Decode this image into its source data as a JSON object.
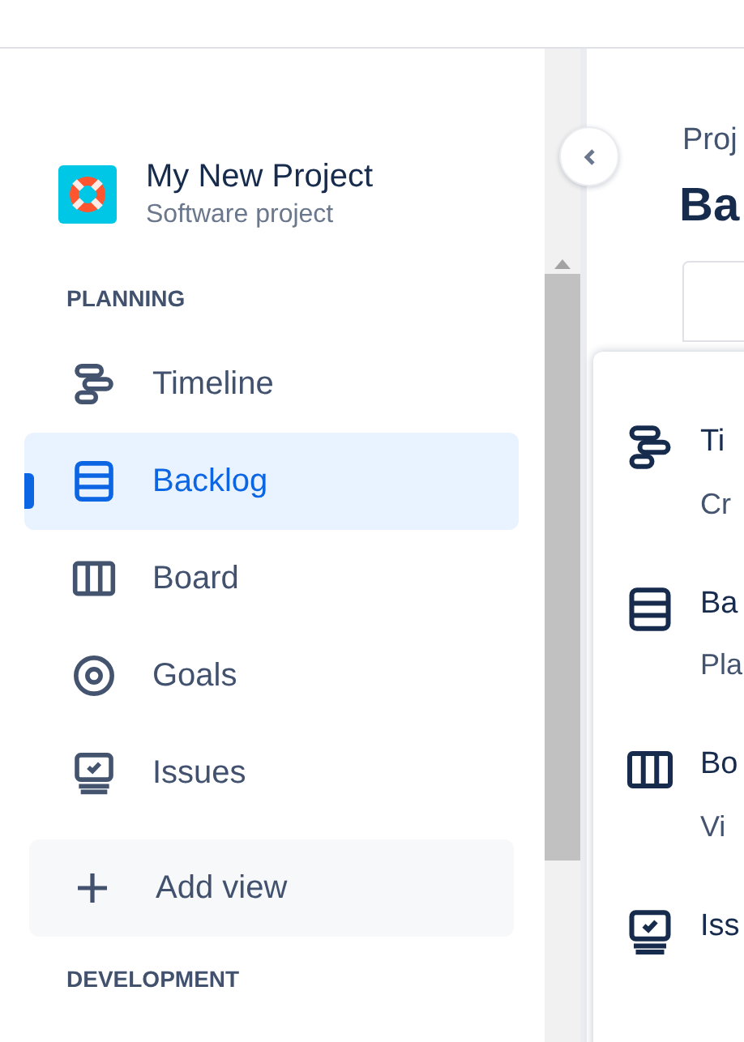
{
  "project": {
    "name": "My New Project",
    "type": "Software project"
  },
  "sections": [
    {
      "heading": "PLANNING",
      "items": [
        {
          "label": "Timeline",
          "kind": "timeline",
          "selected": false
        },
        {
          "label": "Backlog",
          "kind": "backlog",
          "selected": true
        },
        {
          "label": "Board",
          "kind": "board",
          "selected": false
        },
        {
          "label": "Goals",
          "kind": "goals",
          "selected": false
        },
        {
          "label": "Issues",
          "kind": "issues",
          "selected": false
        }
      ],
      "add_view": "Add view"
    },
    {
      "heading": "DEVELOPMENT"
    }
  ],
  "main": {
    "breadcrumb": "Proj",
    "title": "Ba"
  },
  "dropdown": {
    "items": [
      {
        "kind": "timeline",
        "title": "Ti",
        "description": "Cr"
      },
      {
        "kind": "backlog",
        "title": "Ba",
        "description": "Pla"
      },
      {
        "kind": "board",
        "title": "Bo",
        "description": "Vi"
      },
      {
        "kind": "issues",
        "title": "Iss"
      }
    ]
  }
}
